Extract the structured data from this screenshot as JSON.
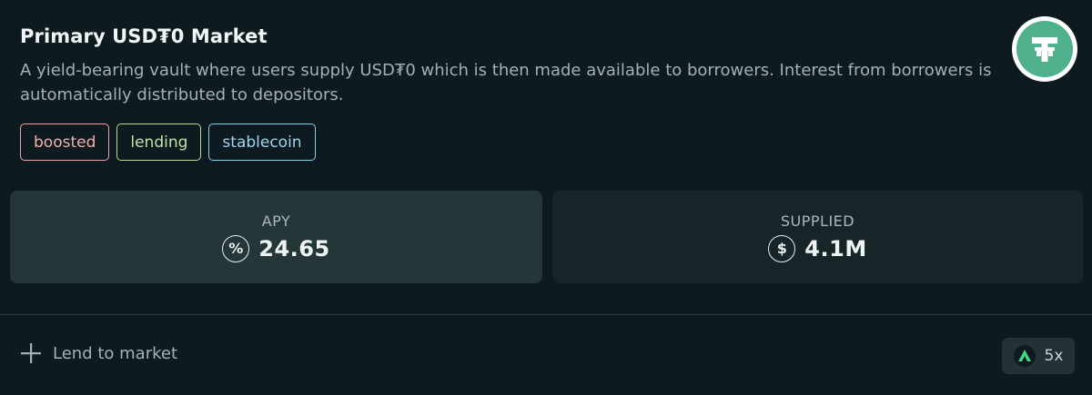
{
  "market": {
    "title": "Primary USD₮0 Market",
    "description": "A yield-bearing vault where users supply USD₮0 which is then made available to borrowers. Interest from borrowers is automatically distributed to depositors.",
    "logo_icon": "tether-usdt0-icon"
  },
  "tags": [
    {
      "label": "boosted",
      "color": "#e9a8a4"
    },
    {
      "label": "lending",
      "color": "#b7dba0"
    },
    {
      "label": "stablecoin",
      "color": "#8fcde6"
    }
  ],
  "stats": {
    "apy": {
      "label": "APY",
      "icon": "percent-icon",
      "icon_glyph": "%",
      "value": "24.65"
    },
    "supplied": {
      "label": "SUPPLIED",
      "icon": "dollar-icon",
      "icon_glyph": "$",
      "value": "4.1M"
    }
  },
  "footer": {
    "lend_label": "Lend to market",
    "boost_multiplier": "5x"
  },
  "colors": {
    "background": "#0d1a1f",
    "apy_card": "#253639",
    "supplied_card": "#172528",
    "logo_green": "#4fb08c",
    "boost_green": "#3fd982"
  }
}
